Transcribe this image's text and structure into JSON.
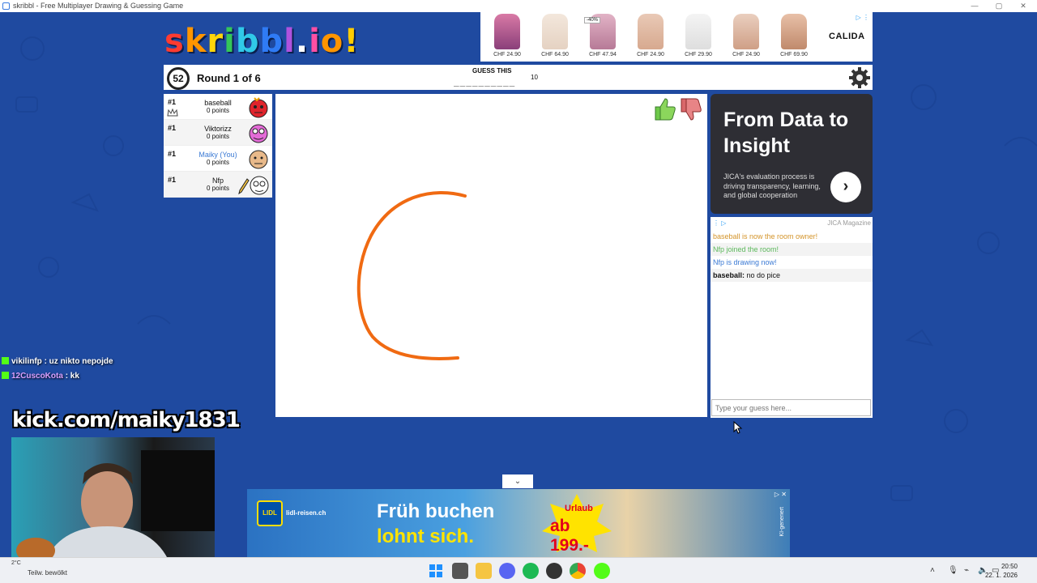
{
  "window": {
    "title": "skribbl - Free Multiplayer Drawing & Guessing Game",
    "controls": [
      "—",
      "▢",
      "✕"
    ]
  },
  "logo": {
    "letters": [
      "s",
      "k",
      "r",
      "i",
      "b",
      "b",
      "l",
      ".",
      "i",
      "o",
      "!"
    ],
    "colors": [
      "#ff3b30",
      "#ff9500",
      "#ffd60a",
      "#34c759",
      "#30c9e8",
      "#2f7bf5",
      "#af52de",
      "#ffffff",
      "#ff4fa3",
      "#ff9500",
      "#ffcc00"
    ]
  },
  "top_ad": {
    "products": [
      {
        "price": "CHF 24.90",
        "badge": ""
      },
      {
        "price": "CHF 64.90",
        "badge": ""
      },
      {
        "price": "CHF 47.94",
        "badge": "-40%"
      },
      {
        "price": "CHF 24.90",
        "badge": ""
      },
      {
        "price": "CHF 29.90",
        "badge": ""
      },
      {
        "price": "CHF 24.90",
        "badge": ""
      },
      {
        "price": "CHF 69.90",
        "badge": ""
      }
    ],
    "brand": "CALIDA"
  },
  "game": {
    "timer": "52",
    "round": "Round 1 of 6",
    "guess_label": "GUESS THIS",
    "word_blanks": "__________",
    "word_length": "10"
  },
  "players": [
    {
      "rank": "#1",
      "name": "baseball",
      "points": "0 points",
      "you": false,
      "color": "#e0242c"
    },
    {
      "rank": "#1",
      "name": "Viktorizz",
      "points": "0 points",
      "you": false,
      "color": "#e36bd7"
    },
    {
      "rank": "#1",
      "name": "Maiky (You)",
      "points": "0 points",
      "you": true,
      "color": "#e8b98a"
    },
    {
      "rank": "#1",
      "name": "Nfp",
      "points": "0 points",
      "you": false,
      "color": "#ffffff"
    }
  ],
  "side_ad": {
    "headline": "From Data to Insight",
    "body": "JICA's evaluation process is driving transparency, learning, and global cooperation",
    "source": "JICA Magazine",
    "arrow": "›"
  },
  "chat": {
    "messages": [
      {
        "type": "owner",
        "text": "baseball is now the room owner!"
      },
      {
        "type": "join",
        "text": "Nfp joined the room!"
      },
      {
        "type": "draw",
        "text": "Nfp is drawing now!"
      },
      {
        "type": "chat",
        "user": "baseball:",
        "text": "no do pice"
      }
    ],
    "input_placeholder": "Type your guess here..."
  },
  "stream": {
    "chat": [
      {
        "user": "vikilinfp",
        "text": ": uz nikto nepojde"
      },
      {
        "user": "12CuscoKota",
        "text": ": kk"
      }
    ],
    "channel": "kick.com/maiky1831"
  },
  "bottom_ad": {
    "site": "lidl-reisen.ch",
    "logo": "LIDL",
    "line1": "Früh buchen",
    "line2": "lohnt sich.",
    "badge_top": "Urlaub",
    "badge_price": "ab 199.-",
    "note": "KI-generiert"
  },
  "taskbar": {
    "weather": "Teilw. bewölkt",
    "temp": "2°C",
    "time": "20:50",
    "date": "22. 1. 2026"
  },
  "colors": {
    "background": "#1f4aa0",
    "stroke": "#f06a12",
    "accent": "#3b7ad4"
  }
}
